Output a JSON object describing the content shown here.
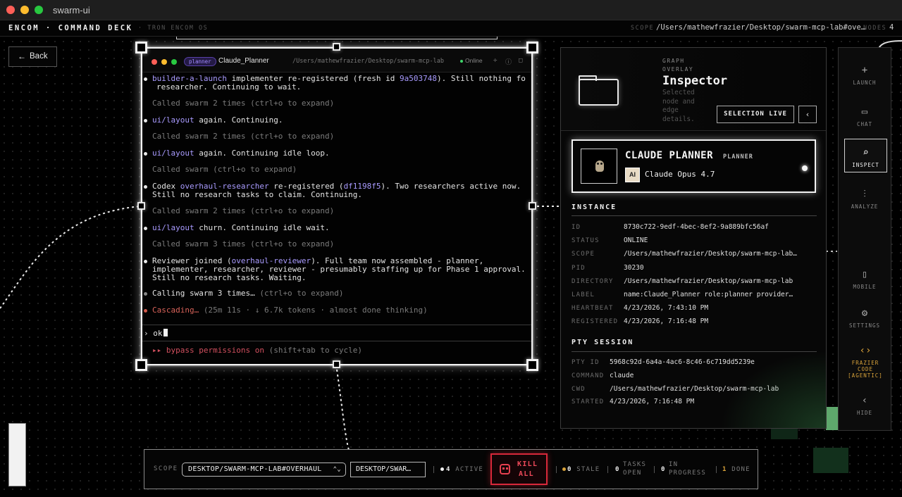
{
  "window": {
    "title": "swarm-ui"
  },
  "topbar": {
    "brand": "ENCOM · COMMAND DECK",
    "subtitle": "· TRON ENCOM OS",
    "scope_label": "SCOPE",
    "scope_value": "/Users/mathewfrazier/Desktop/swarm-mcp-lab#ove…",
    "nodes_label": "NODES",
    "nodes_value": "4"
  },
  "back_button": {
    "label": "Back"
  },
  "terminal": {
    "role_chip": "planner",
    "title": "Claude_Planner",
    "path": "/Users/mathewfrazier/Desktop/swarm-mcp-lab",
    "status": "Online",
    "lines": [
      {
        "parts": [
          {
            "t": "builder-a-launch",
            "c": "purple"
          },
          {
            "t": " implementer re-registered (fresh id ",
            "c": "white"
          },
          {
            "t": "9a503748",
            "c": "purple"
          },
          {
            "t": "). Still nothing fo",
            "c": "white"
          }
        ]
      },
      {
        "parts": [
          {
            "t": "researcher. Continuing to wait.",
            "c": "white"
          }
        ]
      },
      {
        "parts": [
          {
            "t": "Called swarm 2 times (ctrl+o to expand)",
            "c": "muted"
          }
        ]
      },
      {
        "parts": [
          {
            "t": "ui/layout",
            "c": "purple"
          },
          {
            "t": " again. Continuing.",
            "c": "white"
          }
        ]
      },
      {
        "parts": [
          {
            "t": "Called swarm 2 times (ctrl+o to expand)",
            "c": "muted"
          }
        ]
      },
      {
        "parts": [
          {
            "t": "ui/layout",
            "c": "purple"
          },
          {
            "t": " again. Continuing idle loop.",
            "c": "white"
          }
        ]
      },
      {
        "parts": [
          {
            "t": "Called swarm (ctrl+o to expand)",
            "c": "muted"
          }
        ]
      },
      {
        "parts": [
          {
            "t": "Codex ",
            "c": "white"
          },
          {
            "t": "overhaul-researcher",
            "c": "purple"
          },
          {
            "t": " re-registered (",
            "c": "white"
          },
          {
            "t": "df1198f5",
            "c": "purple"
          },
          {
            "t": "). Two researchers active now.",
            "c": "white"
          }
        ]
      },
      {
        "parts": [
          {
            "t": "Still no research tasks to claim. Continuing.",
            "c": "white"
          }
        ]
      },
      {
        "parts": [
          {
            "t": "Called swarm 2 times (ctrl+o to expand)",
            "c": "muted"
          }
        ]
      },
      {
        "parts": [
          {
            "t": "ui/layout",
            "c": "purple"
          },
          {
            "t": " churn. Continuing idle wait.",
            "c": "white"
          }
        ]
      },
      {
        "parts": [
          {
            "t": "Called swarm 3 times (ctrl+o to expand)",
            "c": "muted"
          }
        ]
      },
      {
        "parts": [
          {
            "t": "Reviewer joined (",
            "c": "white"
          },
          {
            "t": "overhaul-reviewer",
            "c": "purple"
          },
          {
            "t": "). Full team now assembled - planner,",
            "c": "white"
          }
        ]
      },
      {
        "parts": [
          {
            "t": "implementer, researcher, reviewer - presumably staffing up for Phase 1 approval.",
            "c": "white"
          }
        ]
      },
      {
        "parts": [
          {
            "t": "Still no research tasks. Waiting.",
            "c": "white"
          }
        ]
      },
      {
        "parts": [
          {
            "t": "Calling swarm 3 times…",
            "c": "white"
          },
          {
            "t": " (ctrl+o to expand)",
            "c": "muted"
          }
        ]
      },
      {
        "parts": [
          {
            "t": "Cascading…",
            "c": "redtxt"
          },
          {
            "t": " (25m 11s · ↓ 6.7k tokens · almost done thinking)",
            "c": "muted"
          }
        ]
      }
    ],
    "prompt_value": "ok",
    "bypass_label": "▸▸ bypass permissions on",
    "bypass_hint": " (shift+tab to cycle)"
  },
  "inspector": {
    "overline": "GRAPH OVERLAY",
    "title": "Inspector",
    "description": "Selected node and edge details.",
    "selection_button": "SELECTION LIVE",
    "collapse_icon": "‹",
    "agent": {
      "name": "CLAUDE PLANNER",
      "role": "PLANNER",
      "model_badge": "AI",
      "model": "Claude Opus 4.7"
    },
    "instance": {
      "header": "INSTANCE",
      "rows": [
        {
          "k": "ID",
          "v": "8730c722-9edf-4bec-8ef2-9a889bfc56af"
        },
        {
          "k": "STATUS",
          "v": "ONLINE"
        },
        {
          "k": "SCOPE",
          "v": "/Users/mathewfrazier/Desktop/swarm-mcp-lab…"
        },
        {
          "k": "PID",
          "v": "30230"
        },
        {
          "k": "DIRECTORY",
          "v": "/Users/mathewfrazier/Desktop/swarm-mcp-lab"
        },
        {
          "k": "LABEL",
          "v": "name:Claude_Planner role:planner provider…"
        },
        {
          "k": "HEARTBEAT",
          "v": "4/23/2026, 7:43:10 PM"
        },
        {
          "k": "REGISTERED",
          "v": "4/23/2026, 7:16:48 PM"
        }
      ]
    },
    "pty": {
      "header": "PTY SESSION",
      "rows": [
        {
          "k": "PTY ID",
          "v": "5968c92d-6a4a-4ac6-8c46-6c719dd5239e"
        },
        {
          "k": "COMMAND",
          "v": "claude"
        },
        {
          "k": "CWD",
          "v": "/Users/mathewfrazier/Desktop/swarm-mcp-lab"
        },
        {
          "k": "STARTED",
          "v": "4/23/2026, 7:16:48 PM"
        }
      ]
    }
  },
  "rail": {
    "items": [
      {
        "icon": "+",
        "label": "LAUNCH"
      },
      {
        "icon": "▭",
        "label": "CHAT"
      },
      {
        "icon": "⌕",
        "label": "INSPECT"
      },
      {
        "icon": "⫶",
        "label": "ANALYZE"
      },
      {
        "icon": "▯",
        "label": "MOBILE"
      },
      {
        "icon": "⚙",
        "label": "SETTINGS"
      },
      {
        "icon": "‹›",
        "label": "FRAZIER CODE [AGENTIC]"
      },
      {
        "icon": "‹",
        "label": "HIDE"
      }
    ]
  },
  "bottom": {
    "scope_label": "SCOPE",
    "scope_select": "DESKTOP/SWARM-MCP-LAB#OVERHAUL",
    "path_chip": "DESKTOP/SWAR…",
    "active_count": "4",
    "active_label": "ACTIVE",
    "kill_label": "KILL ALL",
    "stale_count": "0",
    "stale_label": "STALE",
    "open_count": "0",
    "open_label": "TASKS OPEN",
    "progress_count": "0",
    "progress_label": "IN PROGRESS",
    "done_count": "1",
    "done_label": "DONE"
  },
  "colors": {
    "accent_purple": "#a99bff",
    "online_green": "#3fd46a",
    "danger_red": "#d8283a",
    "done_amber": "#d8a23a"
  }
}
